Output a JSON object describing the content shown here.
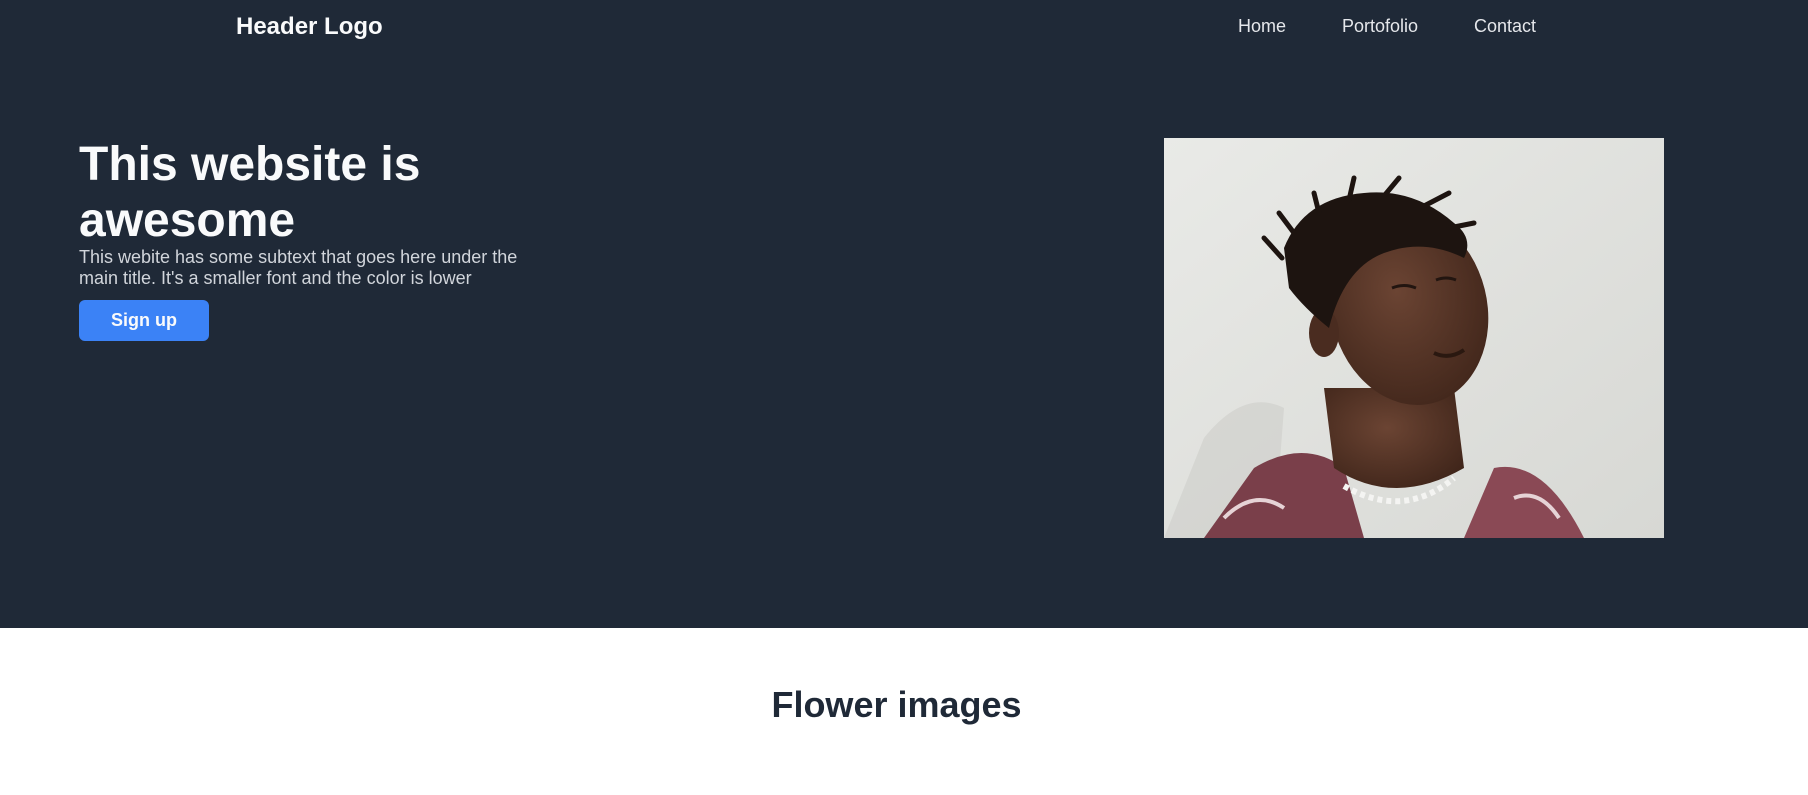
{
  "header": {
    "logo": "Header Logo",
    "nav": [
      {
        "label": "Home"
      },
      {
        "label": "Portofolio"
      },
      {
        "label": "Contact"
      }
    ]
  },
  "hero": {
    "title": "This website is awesome",
    "subtitle": "This webite has some subtext that goes here under the main title. It's a smaller font and the color is lower",
    "button_label": "Sign up",
    "image_subject": "portrait-photo"
  },
  "section": {
    "title": "Flower images"
  },
  "colors": {
    "dark_background": "#1f2937",
    "accent": "#3b82f6",
    "heading_light": "#f9fafb",
    "text_muted": "#d1d5db",
    "heading_dark": "#1f2937"
  }
}
